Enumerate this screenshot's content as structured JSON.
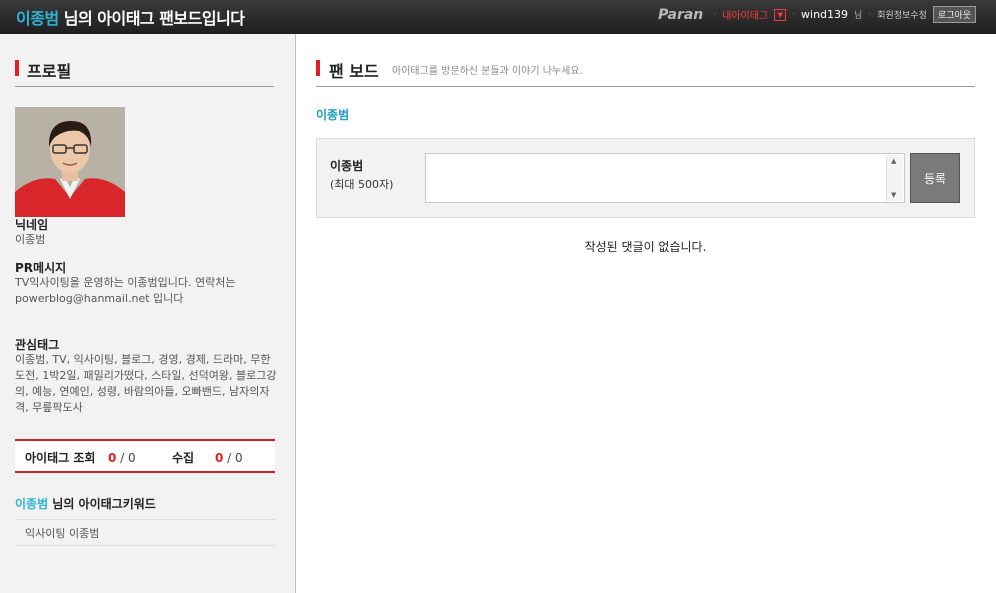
{
  "header": {
    "owner_name": "이종범",
    "title_suffix": " 님의 아이태그 팬보드입니다",
    "brand": "Paran",
    "my_itag": "내아이태그",
    "username": "wind139",
    "nim": "님",
    "edit_profile": "회원정보수정",
    "logout": "로그아웃"
  },
  "sidebar": {
    "profile_title": "프로필",
    "nickname_label": "닉네임",
    "nickname": "이종범",
    "pr_label": "PR메시지",
    "pr_message": "TV익사이팅을 운영하는 이종범입니다. 연락처는 powerblog@hanmail.net 입니다",
    "interest_label": "관심태그",
    "interest_tags": "이종범, TV, 익사이팅, 블로그, 경영, 경제, 드라마, 무한도전, 1박2일, 패밀리가떴다, 스타일, 선덕여왕, 블로그강의, 예능, 연예인, 성령, 바람의아들, 오빠밴드, 남자의자격, 무릎팍도사",
    "stats": {
      "view_label": "아이태그 조회",
      "view_count": "0",
      "view_total": " / 0",
      "collect_label": "수집",
      "collect_count": "0",
      "collect_total": " / 0"
    },
    "keywords_owner": "이종범",
    "keywords_title": " 님의 아이태그키워드",
    "keywords": "익사이팅 이종범"
  },
  "main": {
    "title": "팬 보드",
    "subtitle": "아이태그를 방문하신 분들과 이야기 나누세요.",
    "owner_link": "이종범",
    "form": {
      "name": "이종범",
      "max_length": "(최대 500자)",
      "textarea_value": "",
      "submit_label": "등록"
    },
    "empty_message": "작성된 댓글이 없습니다."
  },
  "colors": {
    "accent_red": "#e21f26",
    "link_blue": "#1a9bbf",
    "header_bg": "#2a2a2a"
  }
}
